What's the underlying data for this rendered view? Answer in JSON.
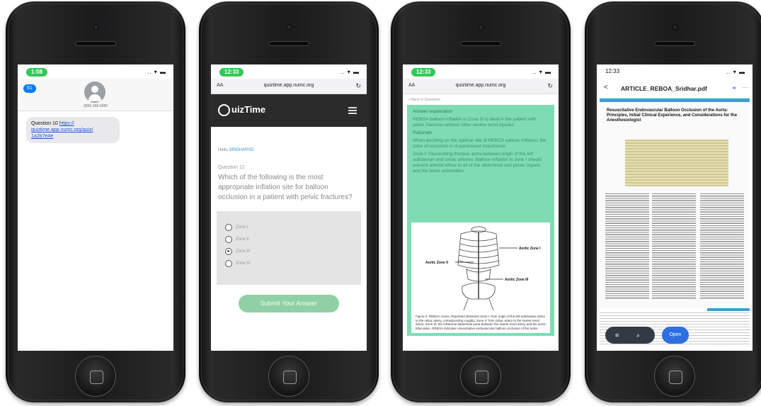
{
  "phone1": {
    "time": "1:08",
    "signal": ".. ▾ ▬",
    "back_label": "61",
    "contact_number": "(888) 888-8888",
    "message_prefix": "Question 10",
    "message_link": "https:// quiztime.app.numc.org/quiz/ 1a2b7e4e"
  },
  "phone2": {
    "time": "12:33",
    "signal": ".. ▾ ▬",
    "aa": "AA",
    "url": "quiztime.app.numc.org",
    "reload": "↻",
    "logo_text": "uizTime",
    "hello_prefix": "Hello",
    "hello_name": "SRIDHARSD",
    "question_number": "Question 12",
    "question_text": "Which of the following is the most appropriate inflation site for balloon occlusion in a patient with pelvic fractures?",
    "choices": [
      {
        "label": "Zone I",
        "selected": false
      },
      {
        "label": "Zone II",
        "selected": false
      },
      {
        "label": "Zone III",
        "selected": true
      },
      {
        "label": "Zone IV",
        "selected": false
      }
    ],
    "submit_label": "Submit Your Answer"
  },
  "phone3": {
    "time": "12:33",
    "signal": ".. ▾ ▬",
    "aa": "AA",
    "url": "quiztime.app.numc.org",
    "reload": "↻",
    "back_link": "< Back to Questions",
    "heading1": "Answer explanation",
    "para1": "REBOA balloon inflation in Zone III is ideal in the patient with pelvic fractures without other severe torso injuries.",
    "heading2": "Rationale",
    "para2": "When deciding on the optimal site of REBOA balloon inflation, the zone of occlusion is of paramount importance.",
    "para3": "Zone I: Descending thoracic aorta between origin of the left subclavian and celiac arteries. Balloon inflation in zone I should prevent arterial inflow to all of the abdominal and pelvic organs and the lower extremities.",
    "label_zone1": "Aortic Zone I",
    "label_zone2": "Aortic Zone II",
    "label_zone3": "Aortic Zone III",
    "caption": "Figure 2. REBOA zones. Reprinted (Elsevier) Zone I: from origin of the left subclavian artery to the celiac artery, corresponding roughly; Zone II: from celiac artery to the lowest renal artery; Zone III: the infrarenal abdominal aorta between the lowest renal artery and the aortic bifurcation. REBOA indicates resuscitative endovascular balloon occlusion of the aorta."
  },
  "phone4": {
    "time": "12:33",
    "signal": ".. ▾ ▬",
    "back": "<",
    "title": "ARTICLE_REBOA_Sridhar.pdf",
    "link_icon": "⚭",
    "more": "⋯",
    "article_heading": "Resuscitative Endovascular Balloon Occlusion of the Aorta: Principles, Initial Clinical Experience, and Considerations for the Anesthesiologist",
    "tools_list": "≡",
    "tools_search": "⌕",
    "open_label": "Open"
  }
}
